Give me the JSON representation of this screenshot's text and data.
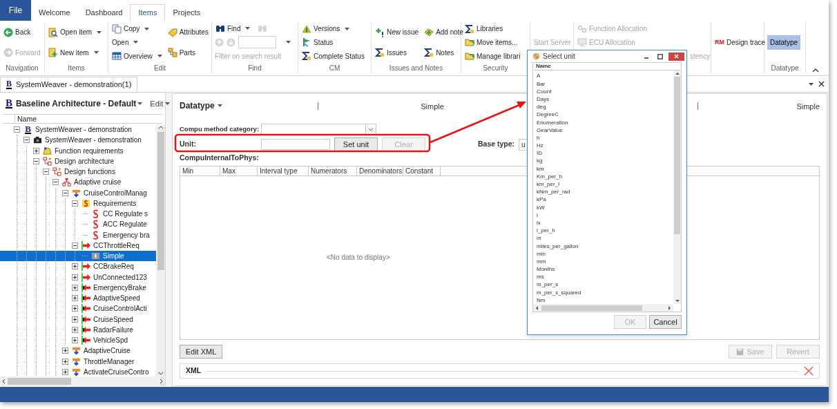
{
  "menu_tabs": [
    {
      "label": "File",
      "kind": "file",
      "selected": false
    },
    {
      "label": "Welcome",
      "kind": "tab",
      "selected": false
    },
    {
      "label": "Dashboard",
      "kind": "tab",
      "selected": false
    },
    {
      "label": "Items",
      "kind": "tab",
      "selected": true
    },
    {
      "label": "Projects",
      "kind": "tab",
      "selected": false
    }
  ],
  "ribbon": {
    "groups": [
      {
        "label": "Navigation",
        "columns": [
          [
            {
              "kind": "button",
              "label": "Back",
              "dropdown": false,
              "disabled": false
            },
            {
              "kind": "button",
              "label": "Forward",
              "dropdown": false,
              "disabled": true
            }
          ]
        ]
      },
      {
        "label": "Items",
        "columns": [
          [
            {
              "kind": "button",
              "label": "Open item",
              "dropdown": true,
              "disabled": false
            },
            {
              "kind": "button",
              "label": "New item",
              "dropdown": true,
              "disabled": false
            }
          ]
        ]
      },
      {
        "label": "Edit",
        "columns": [
          [
            {
              "kind": "button",
              "label": "Copy",
              "dropdown": true,
              "disabled": false
            },
            {
              "kind": "button",
              "label": "Open",
              "dropdown": true,
              "disabled": false
            },
            {
              "kind": "button",
              "label": "Overview",
              "dropdown": true,
              "disabled": false
            }
          ],
          [
            {
              "kind": "button",
              "label": "Attributes",
              "dropdown": false,
              "disabled": false
            },
            {
              "kind": "button",
              "label": "Parts",
              "dropdown": false,
              "disabled": false
            }
          ]
        ]
      },
      {
        "label": "Find",
        "columns": [
          [
            {
              "kind": "pair",
              "items": [
                {
                  "kind": "button",
                  "label": "Find",
                  "dropdown": true,
                  "disabled": false
                },
                {
                  "kind": "icon-button",
                  "disabled": true
                }
              ]
            },
            {
              "kind": "search",
              "disabled": true
            },
            {
              "kind": "caption",
              "label": "Filter on search result",
              "disabled": true
            }
          ]
        ]
      },
      {
        "label": "CM",
        "columns": [
          [
            {
              "kind": "button",
              "label": "Versions",
              "dropdown": true,
              "disabled": false
            },
            {
              "kind": "button",
              "label": "Status",
              "dropdown": false,
              "disabled": false
            },
            {
              "kind": "button",
              "label": "Complete Status",
              "dropdown": false,
              "disabled": false
            }
          ]
        ]
      },
      {
        "label": "Issues and Notes",
        "columns": [
          [
            {
              "kind": "button",
              "label": "New issue",
              "dropdown": false,
              "disabled": false
            },
            {
              "kind": "button",
              "label": "Issues",
              "dropdown": false,
              "disabled": false
            }
          ],
          [
            {
              "kind": "button",
              "label": "Add note",
              "dropdown": false,
              "disabled": false
            },
            {
              "kind": "button",
              "label": "Notes",
              "dropdown": false,
              "disabled": false
            }
          ]
        ]
      },
      {
        "label": "Security",
        "columns": [
          [
            {
              "kind": "button",
              "label": "Libraries",
              "dropdown": false,
              "disabled": false
            },
            {
              "kind": "button",
              "label": "Move items...",
              "dropdown": false,
              "disabled": false
            },
            {
              "kind": "button",
              "label": "Manage librari",
              "dropdown": false,
              "disabled": false
            }
          ]
        ]
      },
      {
        "columns": [
          [
            {
              "kind": "button",
              "label": "Start Server",
              "dropdown": false,
              "disabled": true
            }
          ]
        ]
      },
      {
        "columns": [
          [
            {
              "kind": "button",
              "label": "Function Allocation",
              "dropdown": false,
              "disabled": true
            },
            {
              "kind": "button",
              "label": "ECU Allocation",
              "dropdown": false,
              "disabled": true
            },
            {
              "kind": "partial",
              "label": "stency",
              "disabled": true
            }
          ]
        ]
      },
      {
        "columns": [
          [
            {
              "kind": "button",
              "label": "Design trace",
              "badge": "RM",
              "dropdown": false,
              "disabled": false
            }
          ]
        ]
      },
      {
        "label": "Datatype",
        "columns": [
          [
            {
              "kind": "toggle",
              "label": "Datatype",
              "selected": true
            }
          ]
        ]
      }
    ]
  },
  "doc_tab": {
    "logo": "B",
    "label": "SystemWeaver - demonstration(1)"
  },
  "tree": {
    "logo": "B",
    "title": "Baseline Architecture - Default",
    "edit_menu": "Edit",
    "column": "Name",
    "nodes": [
      {
        "label": "SystemWeaver - demonstration",
        "kind": "baseline",
        "logo": "B",
        "expanded": true,
        "selected": false,
        "children": [
          {
            "label": "SystemWeaver -  demonstration",
            "kind": "version",
            "expanded": true,
            "selected": false,
            "children": [
              {
                "label": "Function requirements",
                "kind": "requirements-folder",
                "expanded": false,
                "selected": false
              },
              {
                "label": "Design architecture",
                "kind": "design-folder",
                "expanded": true,
                "selected": false,
                "children": [
                  {
                    "label": "Design functions",
                    "kind": "design-functions",
                    "expanded": true,
                    "selected": false,
                    "children": [
                      {
                        "label": "Adaptive cruise",
                        "kind": "composition",
                        "expanded": true,
                        "selected": false,
                        "children": [
                          {
                            "label": "CruiseControlManag",
                            "kind": "component",
                            "expanded": true,
                            "selected": false,
                            "children": [
                              {
                                "label": "Requirements",
                                "kind": "requirements",
                                "expanded": true,
                                "selected": false,
                                "children": [
                                  {
                                    "label": "CC Regulate s",
                                    "kind": "requirement",
                                    "selected": false
                                  },
                                  {
                                    "label": "ACC Regulate",
                                    "kind": "requirement",
                                    "selected": false
                                  },
                                  {
                                    "label": "Emergency bra",
                                    "kind": "requirement",
                                    "selected": false
                                  }
                                ]
                              },
                              {
                                "label": "CCThrottleReq",
                                "kind": "port-out",
                                "expanded": true,
                                "selected": false,
                                "children": [
                                  {
                                    "label": "Simple",
                                    "kind": "datatype",
                                    "selected": true
                                  }
                                ]
                              },
                              {
                                "label": "CCBrakeReq",
                                "kind": "port-out",
                                "expanded": false,
                                "selected": false
                              },
                              {
                                "label": "UnConnected123",
                                "kind": "port-out",
                                "expanded": false,
                                "selected": false
                              },
                              {
                                "label": "EmergencyBrake",
                                "kind": "port-in",
                                "expanded": false,
                                "selected": false
                              },
                              {
                                "label": "AdaptiveSpeed",
                                "kind": "port-in",
                                "expanded": false,
                                "selected": false
                              },
                              {
                                "label": "CruiseControlActi",
                                "kind": "port-in",
                                "expanded": false,
                                "selected": false
                              },
                              {
                                "label": "CruiseSpeed",
                                "kind": "port-in",
                                "expanded": false,
                                "selected": false
                              },
                              {
                                "label": "RadarFailure",
                                "kind": "port-in",
                                "expanded": false,
                                "selected": false
                              },
                              {
                                "label": "VehicleSpd",
                                "kind": "port-in",
                                "expanded": false,
                                "selected": false
                              }
                            ]
                          },
                          {
                            "label": "AdaptiveCruise",
                            "kind": "component",
                            "expanded": false,
                            "selected": false
                          },
                          {
                            "label": "ThrottleManager",
                            "kind": "component",
                            "expanded": false,
                            "selected": false
                          },
                          {
                            "label": "ActivateCruiseContro",
                            "kind": "component",
                            "expanded": false,
                            "selected": false
                          }
                        ]
                      }
                    ]
                  }
                ]
              }
            ]
          }
        ]
      }
    ]
  },
  "panel": {
    "title": "Datatype",
    "fields": [
      "Simple",
      "Simple"
    ],
    "compu_method": {
      "label": "Compu method category:"
    },
    "unit": {
      "label": "Unit:",
      "buttons": [
        {
          "label": "Set unit",
          "disabled": false
        },
        {
          "label": "Clear",
          "disabled": true
        }
      ]
    },
    "base_type": {
      "label": "Base type:",
      "value": "u"
    },
    "table": {
      "title": "CompuInternalToPhys:",
      "columns": [
        "Min",
        "Max",
        "Interval type",
        "Numerators",
        "Denominators",
        "Constant"
      ],
      "empty_text": "<No data to display>"
    },
    "edit_xml": "Edit XML",
    "actions": [
      {
        "label": "Save",
        "kind": "save",
        "disabled": true
      },
      {
        "label": "Revert",
        "kind": "plain",
        "disabled": true
      }
    ],
    "xml_group": "XML"
  },
  "dialog": {
    "title": "Select unit",
    "column": "Name",
    "units": [
      "A",
      "Bar",
      "Count",
      "Days",
      "deg",
      "DegreeC",
      "Enumeration",
      "GearValue",
      "h",
      "Hz",
      "ID",
      "kg",
      "km",
      "Km_per_h",
      "km_per_l",
      "kNm_per_rad",
      "kPa",
      "kW",
      "l",
      "lx",
      "l_per_h",
      "m",
      "miles_per_gallon",
      "min",
      "mm",
      "Months",
      "ms",
      "m_per_s",
      "m_per_s_squared",
      "Nm"
    ],
    "buttons": [
      {
        "label": "OK",
        "disabled": true
      },
      {
        "label": "Cancel",
        "disabled": false
      }
    ]
  }
}
